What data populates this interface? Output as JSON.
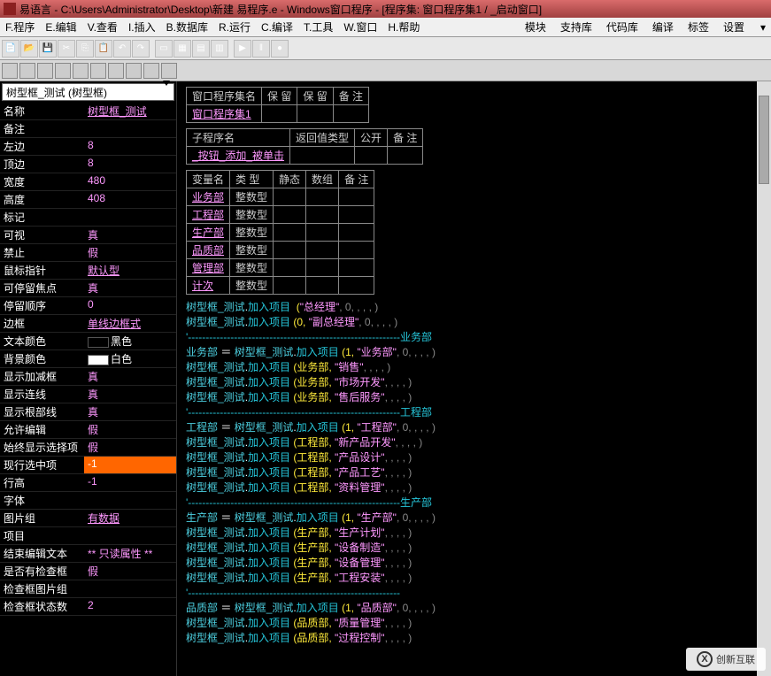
{
  "title": "易语言 - C:\\Users\\Administrator\\Desktop\\新建 易程序.e - Windows窗口程序 - [程序集: 窗口程序集1 / _启动窗口]",
  "menu": {
    "left": [
      "F.程序",
      "E.编辑",
      "V.查看",
      "I.插入",
      "B.数据库",
      "R.运行",
      "C.编译",
      "T.工具",
      "W.窗口",
      "H.帮助"
    ],
    "right": [
      "模块",
      "支持库",
      "代码库",
      "编译",
      "标签",
      "设置"
    ]
  },
  "toolbar_icons": [
    "new",
    "open",
    "save",
    "cut",
    "copy",
    "paste",
    "undo",
    "redo",
    "",
    "form1",
    "form2",
    "form3",
    "form4",
    "",
    "run",
    "pause",
    "stop-rec"
  ],
  "toolbar2_icons": [
    "t1",
    "t2",
    "t3",
    "t4",
    "t5",
    "t6",
    "t7",
    "t8",
    "t9",
    "t10"
  ],
  "sidebar": {
    "dropdown": "树型框_测试 (树型框)",
    "props": [
      {
        "k": "名称",
        "v": "树型框_测试",
        "c": "pink underline"
      },
      {
        "k": "备注",
        "v": "",
        "c": ""
      },
      {
        "k": "左边",
        "v": "8",
        "c": "pink"
      },
      {
        "k": "顶边",
        "v": "8",
        "c": "pink"
      },
      {
        "k": "宽度",
        "v": "480",
        "c": "pink"
      },
      {
        "k": "高度",
        "v": "408",
        "c": "pink"
      },
      {
        "k": "标记",
        "v": "",
        "c": ""
      },
      {
        "k": "可视",
        "v": "真",
        "c": "pink"
      },
      {
        "k": "禁止",
        "v": "假",
        "c": "pink"
      },
      {
        "k": "鼠标指针",
        "v": "默认型",
        "c": "pink underline"
      },
      {
        "k": "可停留焦点",
        "v": "真",
        "c": "pink"
      },
      {
        "k": "停留顺序",
        "v": "0",
        "c": "pink"
      },
      {
        "k": "边框",
        "v": "单线边框式",
        "c": "pink underline"
      },
      {
        "k": "文本颜色",
        "v": "黑色",
        "c": "swatch-black"
      },
      {
        "k": "背景颜色",
        "v": "白色",
        "c": "swatch-white"
      },
      {
        "k": "显示加减框",
        "v": "真",
        "c": "pink"
      },
      {
        "k": "显示连线",
        "v": "真",
        "c": "pink"
      },
      {
        "k": "显示根部线",
        "v": "真",
        "c": "pink"
      },
      {
        "k": "允许编辑",
        "v": "假",
        "c": "pink"
      },
      {
        "k": "始终显示选择项",
        "v": "假",
        "c": "pink"
      },
      {
        "k": "现行选中项",
        "v": "-1",
        "c": "hl"
      },
      {
        "k": "行高",
        "v": "-1",
        "c": "pink"
      },
      {
        "k": "字体",
        "v": "",
        "c": ""
      },
      {
        "k": "图片组",
        "v": "有数据",
        "c": "pink underline"
      },
      {
        "k": "项目",
        "v": "",
        "c": ""
      },
      {
        "k": "结束编辑文本",
        "v": "** 只读属性 **",
        "c": "pink"
      },
      {
        "k": "是否有检查框",
        "v": "假",
        "c": "pink"
      },
      {
        "k": "检查框图片组",
        "v": "",
        "c": ""
      },
      {
        "k": "检查框状态数",
        "v": "2",
        "c": "pink"
      }
    ]
  },
  "editor": {
    "tbl1": {
      "hdr": [
        "窗口程序集名",
        "保 留",
        "保 留",
        "备 注"
      ],
      "row": [
        "窗口程序集1",
        "",
        "",
        ""
      ]
    },
    "tbl2": {
      "hdr": [
        "子程序名",
        "返回值类型",
        "公开",
        "备 注"
      ],
      "row": [
        "_按钮_添加_被单击",
        "",
        "",
        ""
      ]
    },
    "tbl3": {
      "hdr": [
        "变量名",
        "类 型",
        "静态",
        "数组",
        "备 注"
      ],
      "rows": [
        [
          "业务部",
          "整数型",
          "",
          "",
          ""
        ],
        [
          "工程部",
          "整数型",
          "",
          "",
          ""
        ],
        [
          "生产部",
          "整数型",
          "",
          "",
          ""
        ],
        [
          "品质部",
          "整数型",
          "",
          "",
          ""
        ],
        [
          "管理部",
          "整数型",
          "",
          "",
          ""
        ],
        [
          "计次",
          "整数型",
          "",
          "",
          ""
        ]
      ]
    },
    "code": {
      "l1": {
        "o": "树型框_测试.",
        "m": "加入项目",
        "args": [
          "  (",
          "\"总经理\"",
          ", 0, , , , )"
        ]
      },
      "l2": {
        "o": "树型框_测试.",
        "m": "加入项目",
        "args": [
          " (0, ",
          "\"副总经理\"",
          ", 0, , , , )"
        ]
      },
      "sep1": "'------------------------------------------------------------业务部",
      "l3": {
        "a": "业务部 ＝ 树型框_测试.",
        "m": "加入项目",
        "args": [
          " (1, ",
          "\"业务部\"",
          ", 0, , , , )"
        ]
      },
      "l4": {
        "o": "树型框_测试.",
        "m": "加入项目",
        "args": [
          " (业务部, ",
          "\"销售\"",
          ", , , , )"
        ]
      },
      "l5": {
        "o": "树型框_测试.",
        "m": "加入项目",
        "args": [
          " (业务部, ",
          "\"市场开发\"",
          ", , , , )"
        ]
      },
      "l6": {
        "o": "树型框_测试.",
        "m": "加入项目",
        "args": [
          " (业务部, ",
          "\"售后服务\"",
          ", , , , )"
        ]
      },
      "sep2": "'------------------------------------------------------------工程部",
      "l7": {
        "a": "工程部 ＝ 树型框_测试.",
        "m": "加入项目",
        "args": [
          " (1, ",
          "\"工程部\"",
          ", 0, , , , )"
        ]
      },
      "l8": {
        "o": "树型框_测试.",
        "m": "加入项目",
        "args": [
          " (工程部, ",
          "\"新产品开发\"",
          ", , , , )"
        ]
      },
      "l9": {
        "o": "树型框_测试.",
        "m": "加入项目",
        "args": [
          " (工程部, ",
          "\"产品设计\"",
          ", , , , )"
        ]
      },
      "l10": {
        "o": "树型框_测试.",
        "m": "加入项目",
        "args": [
          " (工程部, ",
          "\"产品工艺\"",
          ", , , , )"
        ]
      },
      "l11": {
        "o": "树型框_测试.",
        "m": "加入项目",
        "args": [
          " (工程部, ",
          "\"资料管理\"",
          ", , , , )"
        ]
      },
      "sep3": "'------------------------------------------------------------生产部",
      "l12": {
        "a": "生产部 ＝ 树型框_测试.",
        "m": "加入项目",
        "args": [
          " (1, ",
          "\"生产部\"",
          ", 0, , , , )"
        ]
      },
      "l13": {
        "o": "树型框_测试.",
        "m": "加入项目",
        "args": [
          " (生产部, ",
          "\"生产计划\"",
          ", , , , )"
        ]
      },
      "l14": {
        "o": "树型框_测试.",
        "m": "加入项目",
        "args": [
          " (生产部, ",
          "\"设备制造\"",
          ", , , , )"
        ]
      },
      "l15": {
        "o": "树型框_测试.",
        "m": "加入项目",
        "args": [
          " (生产部, ",
          "\"设备管理\"",
          ", , , , )"
        ]
      },
      "l16": {
        "o": "树型框_测试.",
        "m": "加入项目",
        "args": [
          " (生产部, ",
          "\"工程安装\"",
          ", , , , )"
        ]
      },
      "sep4": "'------------------------------------------------------------",
      "l17": {
        "a": "品质部 ＝ 树型框_测试.",
        "m": "加入项目",
        "args": [
          " (1, ",
          "\"品质部\"",
          ", 0, , , , )"
        ]
      },
      "l18": {
        "o": "树型框_测试.",
        "m": "加入项目",
        "args": [
          " (品质部, ",
          "\"质量管理\"",
          ", , , , )"
        ]
      },
      "l19": {
        "o": "树型框_测试.",
        "m": "加入项目",
        "args": [
          " (品质部, ",
          "\"过程控制\"",
          ", , , , )"
        ]
      }
    }
  },
  "watermark": "创新互联"
}
